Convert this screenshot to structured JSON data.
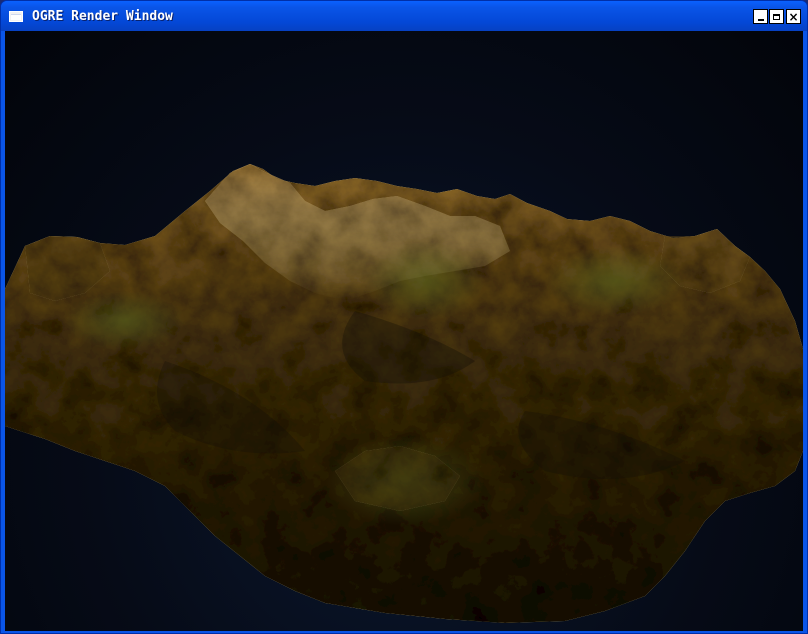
{
  "window": {
    "title": "OGRE Render Window",
    "icon": "app-window-icon",
    "controls": {
      "minimize_icon": "minimize-icon",
      "maximize_icon": "maximize-icon",
      "close_icon": "close-icon",
      "close_glyph": "×"
    }
  },
  "scene": {
    "content": "terrain",
    "colors": {
      "sky_top": "#02040a",
      "sky_mid": "#0b1830",
      "terrain_light": "#b3925d",
      "terrain_mid": "#5b4f2a",
      "terrain_dark": "#1f1a0e",
      "terrain_green": "#4a5a1c"
    }
  }
}
